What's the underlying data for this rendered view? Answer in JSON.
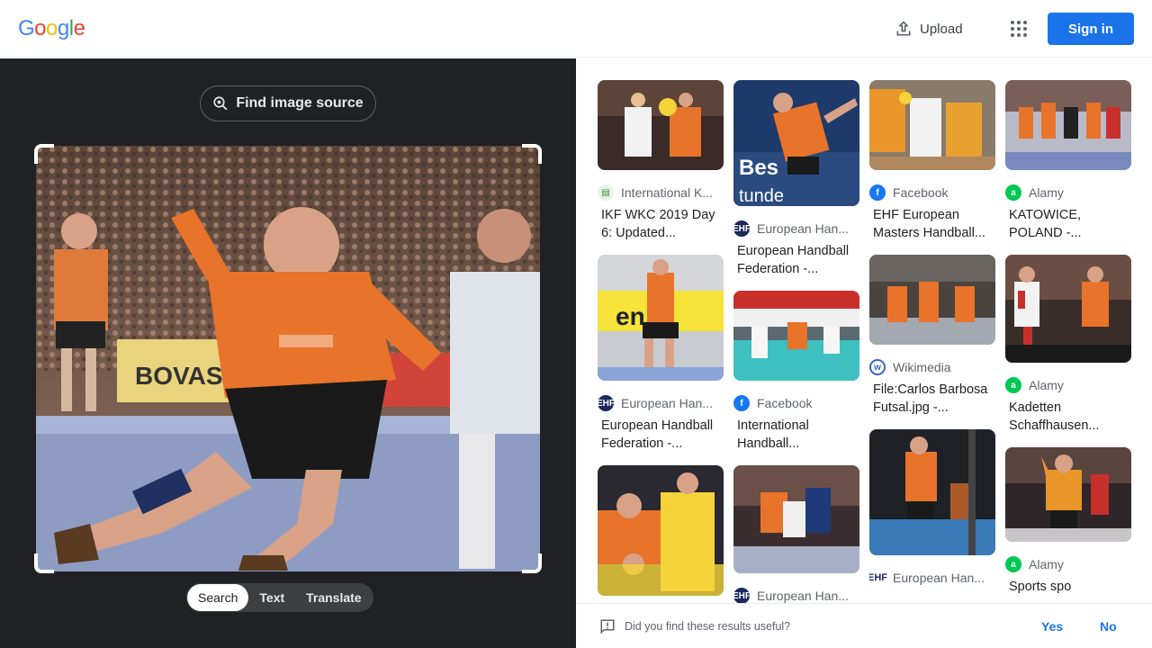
{
  "header": {
    "logo_letters": [
      "G",
      "o",
      "o",
      "g",
      "l",
      "e"
    ],
    "logo_colors": [
      "#4285f4",
      "#ea4335",
      "#fbbc05",
      "#4285f4",
      "#34a853",
      "#ea4335"
    ],
    "upload_label": "Upload",
    "apps_icon": "apps-grid-icon",
    "signin_label": "Sign in"
  },
  "left": {
    "find_source_label": "Find image source",
    "tabs": [
      {
        "label": "Search",
        "active": true
      },
      {
        "label": "Text",
        "active": false
      },
      {
        "label": "Translate",
        "active": false
      }
    ]
  },
  "results": {
    "columns": [
      [
        {
          "source": "International K...",
          "title": "IKF WKC 2019 Day 6: Updated...",
          "icon": "ikf",
          "icon_color": "#fff"
        },
        {
          "source": "European Han...",
          "title": "European Handball Federation -...",
          "icon": "EHF",
          "icon_color": "#1a2a5e"
        },
        {
          "source": "",
          "title": "",
          "icon": "",
          "icon_color": ""
        }
      ],
      [
        {
          "source": "European Han...",
          "title": "European Handball Federation -...",
          "icon": "EHF",
          "icon_color": "#1a2a5e"
        },
        {
          "source": "Facebook",
          "title": "International Handball...",
          "icon": "f",
          "icon_color": "#1877f2"
        },
        {
          "source": "European Han...",
          "title": "",
          "icon": "EHF",
          "icon_color": "#1a2a5e"
        }
      ],
      [
        {
          "source": "Facebook",
          "title": "EHF European Masters Handball...",
          "icon": "f",
          "icon_color": "#1877f2"
        },
        {
          "source": "Wikimedia",
          "title": "File:Carlos Barbosa Futsal.jpg -...",
          "icon": "w",
          "icon_color": "#fff"
        },
        {
          "source": "European Han...",
          "title": "",
          "icon": "EHF",
          "icon_color": "#fff"
        }
      ],
      [
        {
          "source": "Alamy",
          "title": "KATOWICE, POLAND -...",
          "icon": "a",
          "icon_color": "#00c853"
        },
        {
          "source": "Alamy",
          "title": "Kadetten Schaffhausen...",
          "icon": "a",
          "icon_color": "#00c853"
        },
        {
          "source": "Alamy",
          "title": "Sports spo",
          "icon": "a",
          "icon_color": "#00c853"
        }
      ]
    ]
  },
  "feedback": {
    "question": "Did you find these results useful?",
    "yes": "Yes",
    "no": "No"
  },
  "colors": {
    "accent": "#1a73e8",
    "left_bg": "#202124",
    "orange_jersey": "#e8732a"
  }
}
